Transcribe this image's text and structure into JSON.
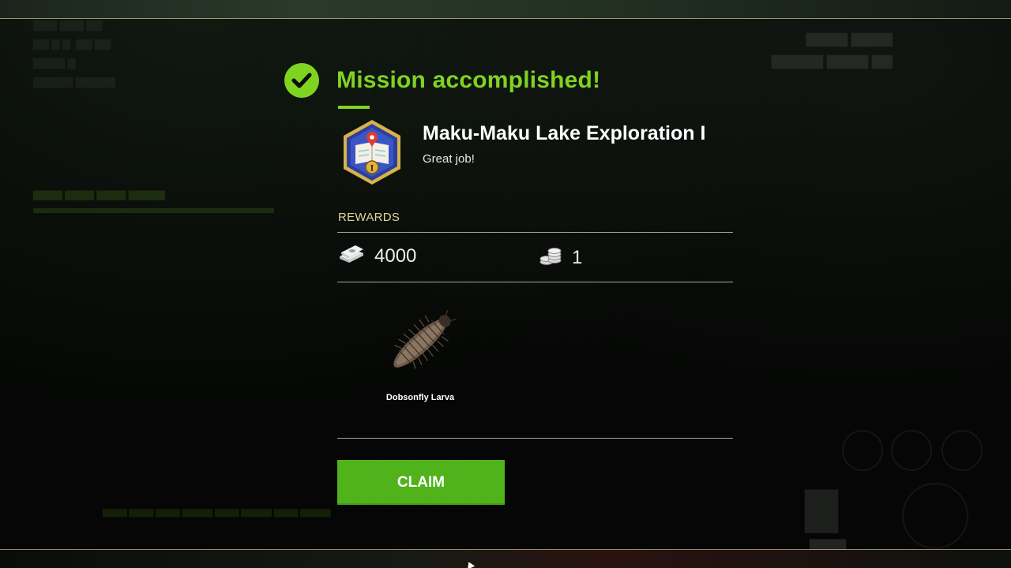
{
  "dialog": {
    "status_title": "Mission accomplished!",
    "mission_name": "Maku-Maku Lake Exploration I",
    "subtitle": "Great job!",
    "badge_icon": "map-pin-badge-icon",
    "badge_numeral": "I",
    "rewards_label": "REWARDS",
    "rewards": {
      "money": {
        "icon": "banknotes-icon",
        "value": "4000"
      },
      "coins": {
        "icon": "coin-stack-icon",
        "value": "1"
      }
    },
    "items": [
      {
        "icon": "dobsonfly-larva-icon",
        "name": "Dobsonfly Larva"
      }
    ],
    "claim_label": "CLAIM"
  },
  "colors": {
    "accent_green": "#7fd321",
    "button_green": "#4fb11a",
    "rewards_label": "#e3d49a",
    "frame_line": "#c9b88a"
  }
}
